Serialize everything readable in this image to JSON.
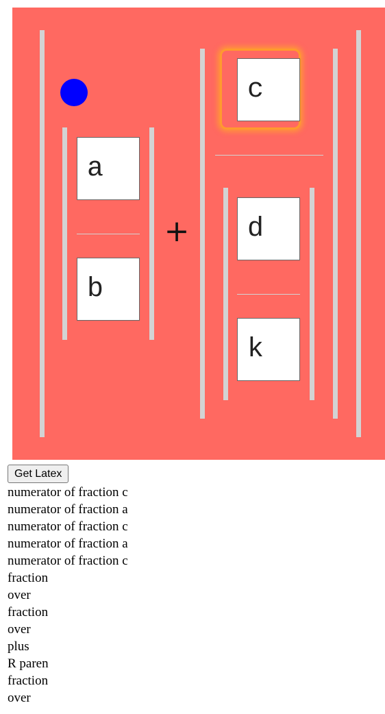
{
  "editor": {
    "background": "#ff6961",
    "bar_color": "#d3d3d3",
    "cursor_color": "#0000ff",
    "focus_color": "#ff9a2e",
    "operator": "+",
    "boxes": {
      "a": "a",
      "b": "b",
      "c": "c",
      "d": "d",
      "k": "k"
    }
  },
  "controls": {
    "latex_button_label": "Get Latex"
  },
  "log": [
    "numerator of fraction c",
    "numerator of fraction a",
    "numerator of fraction c",
    "numerator of fraction a",
    "numerator of fraction c",
    "fraction",
    "over",
    "fraction",
    "over",
    "plus",
    "R paren",
    "fraction",
    "over"
  ]
}
